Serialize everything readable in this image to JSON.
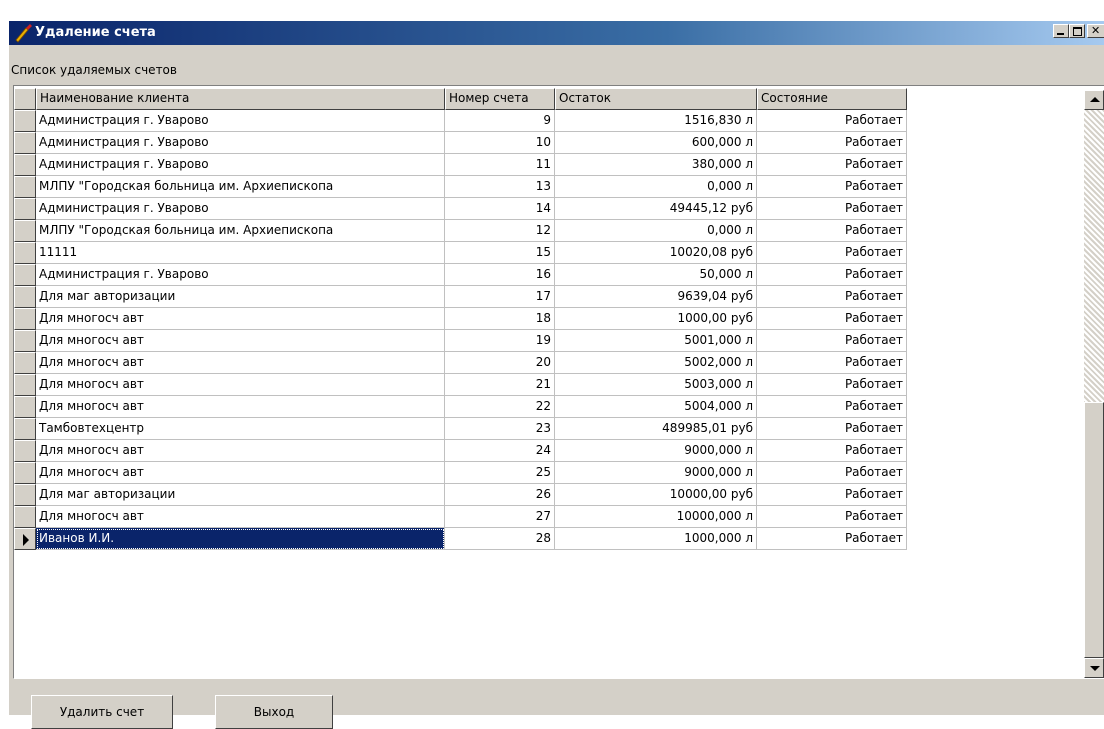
{
  "window": {
    "title": "Удаление счета"
  },
  "list_label": "Список удаляемых счетов",
  "columns": [
    "Наименование клиента",
    "Номер счета",
    "Остаток",
    "Состояние"
  ],
  "rows": [
    {
      "name": "Администрация г. Уварово",
      "number": "9",
      "balance": "1516,830 л",
      "status": "Работает"
    },
    {
      "name": "Администрация г. Уварово",
      "number": "10",
      "balance": "600,000 л",
      "status": "Работает"
    },
    {
      "name": "Администрация г. Уварово",
      "number": "11",
      "balance": "380,000 л",
      "status": "Работает"
    },
    {
      "name": "МЛПУ \"Городская больница им. Архиепископа",
      "number": "13",
      "balance": "0,000 л",
      "status": "Работает"
    },
    {
      "name": "Администрация г. Уварово",
      "number": "14",
      "balance": "49445,12 руб",
      "status": "Работает"
    },
    {
      "name": "МЛПУ \"Городская больница им. Архиепископа",
      "number": "12",
      "balance": "0,000 л",
      "status": "Работает"
    },
    {
      "name": "11111",
      "number": "15",
      "balance": "10020,08 руб",
      "status": "Работает"
    },
    {
      "name": " Администрация г. Уварово",
      "number": "16",
      "balance": "50,000 л",
      "status": "Работает"
    },
    {
      "name": "Для маг авторизации",
      "number": "17",
      "balance": "9639,04 руб",
      "status": "Работает"
    },
    {
      "name": "Для многосч авт",
      "number": "18",
      "balance": "1000,00 руб",
      "status": "Работает"
    },
    {
      "name": "Для многосч авт",
      "number": "19",
      "balance": "5001,000 л",
      "status": "Работает"
    },
    {
      "name": "Для многосч авт",
      "number": "20",
      "balance": "5002,000 л",
      "status": "Работает"
    },
    {
      "name": "Для многосч авт",
      "number": "21",
      "balance": "5003,000 л",
      "status": "Работает"
    },
    {
      "name": "Для многосч авт",
      "number": "22",
      "balance": "5004,000 л",
      "status": "Работает"
    },
    {
      "name": "Тамбовтехцентр",
      "number": "23",
      "balance": "489985,01 руб",
      "status": "Работает"
    },
    {
      "name": " Для многосч авт",
      "number": "24",
      "balance": "9000,000 л",
      "status": "Работает"
    },
    {
      "name": " Для многосч авт",
      "number": "25",
      "balance": "9000,000 л",
      "status": "Работает"
    },
    {
      "name": "Для маг авторизации",
      "number": "26",
      "balance": "10000,00 руб",
      "status": "Работает"
    },
    {
      "name": "Для многосч авт",
      "number": "27",
      "balance": "10000,000 л",
      "status": "Работает"
    },
    {
      "name": "Иванов И.И.",
      "number": "28",
      "balance": "1000,000 л",
      "status": "Работает",
      "selected": true
    }
  ],
  "buttons": {
    "delete": "Удалить счет",
    "exit": "Выход"
  }
}
